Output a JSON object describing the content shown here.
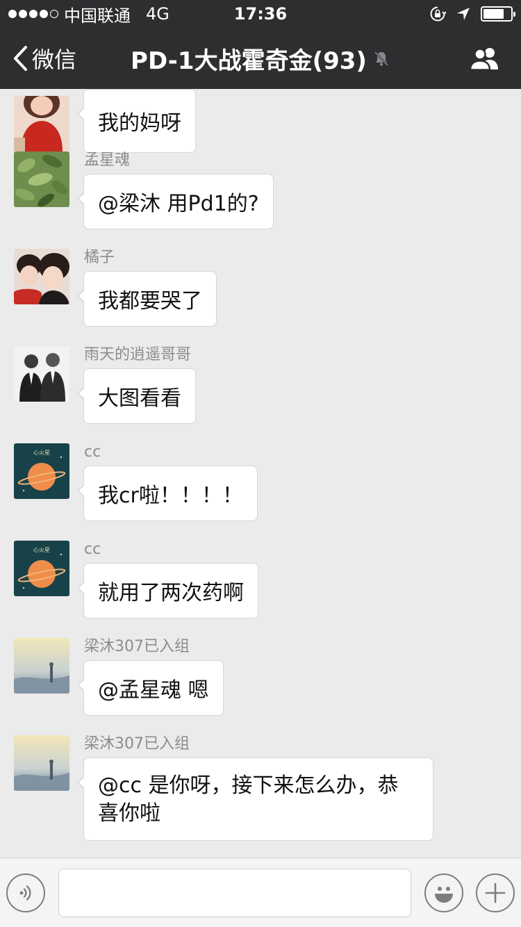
{
  "status_bar": {
    "carrier": "中国联通",
    "network": "4G",
    "time": "17:36",
    "signal_bars": 4,
    "signal_total": 5,
    "battery_level": 0.75
  },
  "nav": {
    "back_label": "微信",
    "title": "PD-1大战霍奇金(93)"
  },
  "messages": [
    {
      "sender": "",
      "text": "我的妈呀"
    },
    {
      "sender": "孟星魂",
      "text": "@梁沐 用Pd1的?"
    },
    {
      "sender": "橘子",
      "text": "我都要哭了"
    },
    {
      "sender": "雨天的逍遥哥哥",
      "text": "大图看看"
    },
    {
      "sender": "cc",
      "text": "我cr啦！！！！"
    },
    {
      "sender": "cc",
      "text": "就用了两次药啊"
    },
    {
      "sender": "梁沐307已入组",
      "text": "@孟星魂 嗯"
    },
    {
      "sender": "梁沐307已入组",
      "text": "@cc 是你呀，接下来怎么办，恭喜你啦"
    }
  ],
  "avatar_images": [
    "girl-red-shirt",
    "plant-leaves",
    "two-girls",
    "two-men-suits",
    "orange-planet-art",
    "orange-planet-art",
    "foggy-landscape",
    "foggy-landscape"
  ],
  "avatar_art_text": "心火星",
  "input": {
    "value": ""
  },
  "icons": {
    "back": "chevron-left-icon",
    "mute": "bell-muted-icon",
    "group": "group-members-icon",
    "voice": "voice-input-icon",
    "emoji": "emoji-icon",
    "more": "plus-icon"
  },
  "colors": {
    "nav_bg": "#2e2e31",
    "chat_bg": "#ebebeb",
    "bubble_bg": "#ffffff",
    "sender_text": "#8c8c8c"
  }
}
